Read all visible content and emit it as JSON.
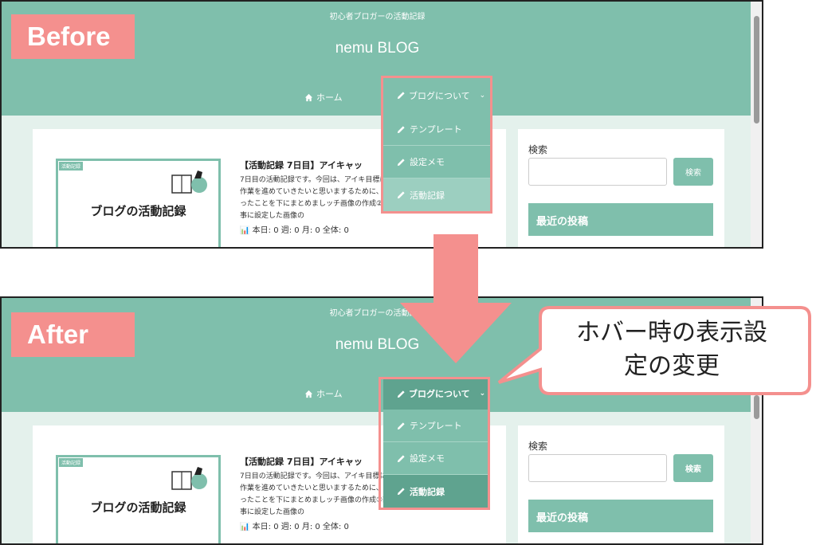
{
  "labels": {
    "before": "Before",
    "after": "After"
  },
  "callout": {
    "line1": "ホバー時の表示設",
    "line2": "定の変更"
  },
  "site": {
    "tagline": "初心者ブロガーの活動記録",
    "name": "nemu BLOG",
    "nav": {
      "home": "ホーム",
      "blog": "ブログについて"
    },
    "dropdown": [
      "テンプレート",
      "設定メモ",
      "活動記録"
    ]
  },
  "post": {
    "badge": "活動記録",
    "thumb_title": "ブログの活動記録",
    "title": "【活動記録 7日目】アイキャッ",
    "excerpt": "7日目の活動記録です。今回は、アイキ目標に作業を進めていきたいと思いまするために、やったことを下にまとめましッチ画像の作成②記事に設定した画像の",
    "meta": "本日: 0  週: 0  月: 0  全体: 0"
  },
  "sidebar": {
    "search_label": "検索",
    "search_button": "検索",
    "recent_heading": "最近の投稿"
  },
  "colors": {
    "accent": "#7fbfac",
    "accent_dark": "#5fa38f",
    "highlight": "#f4908e"
  }
}
